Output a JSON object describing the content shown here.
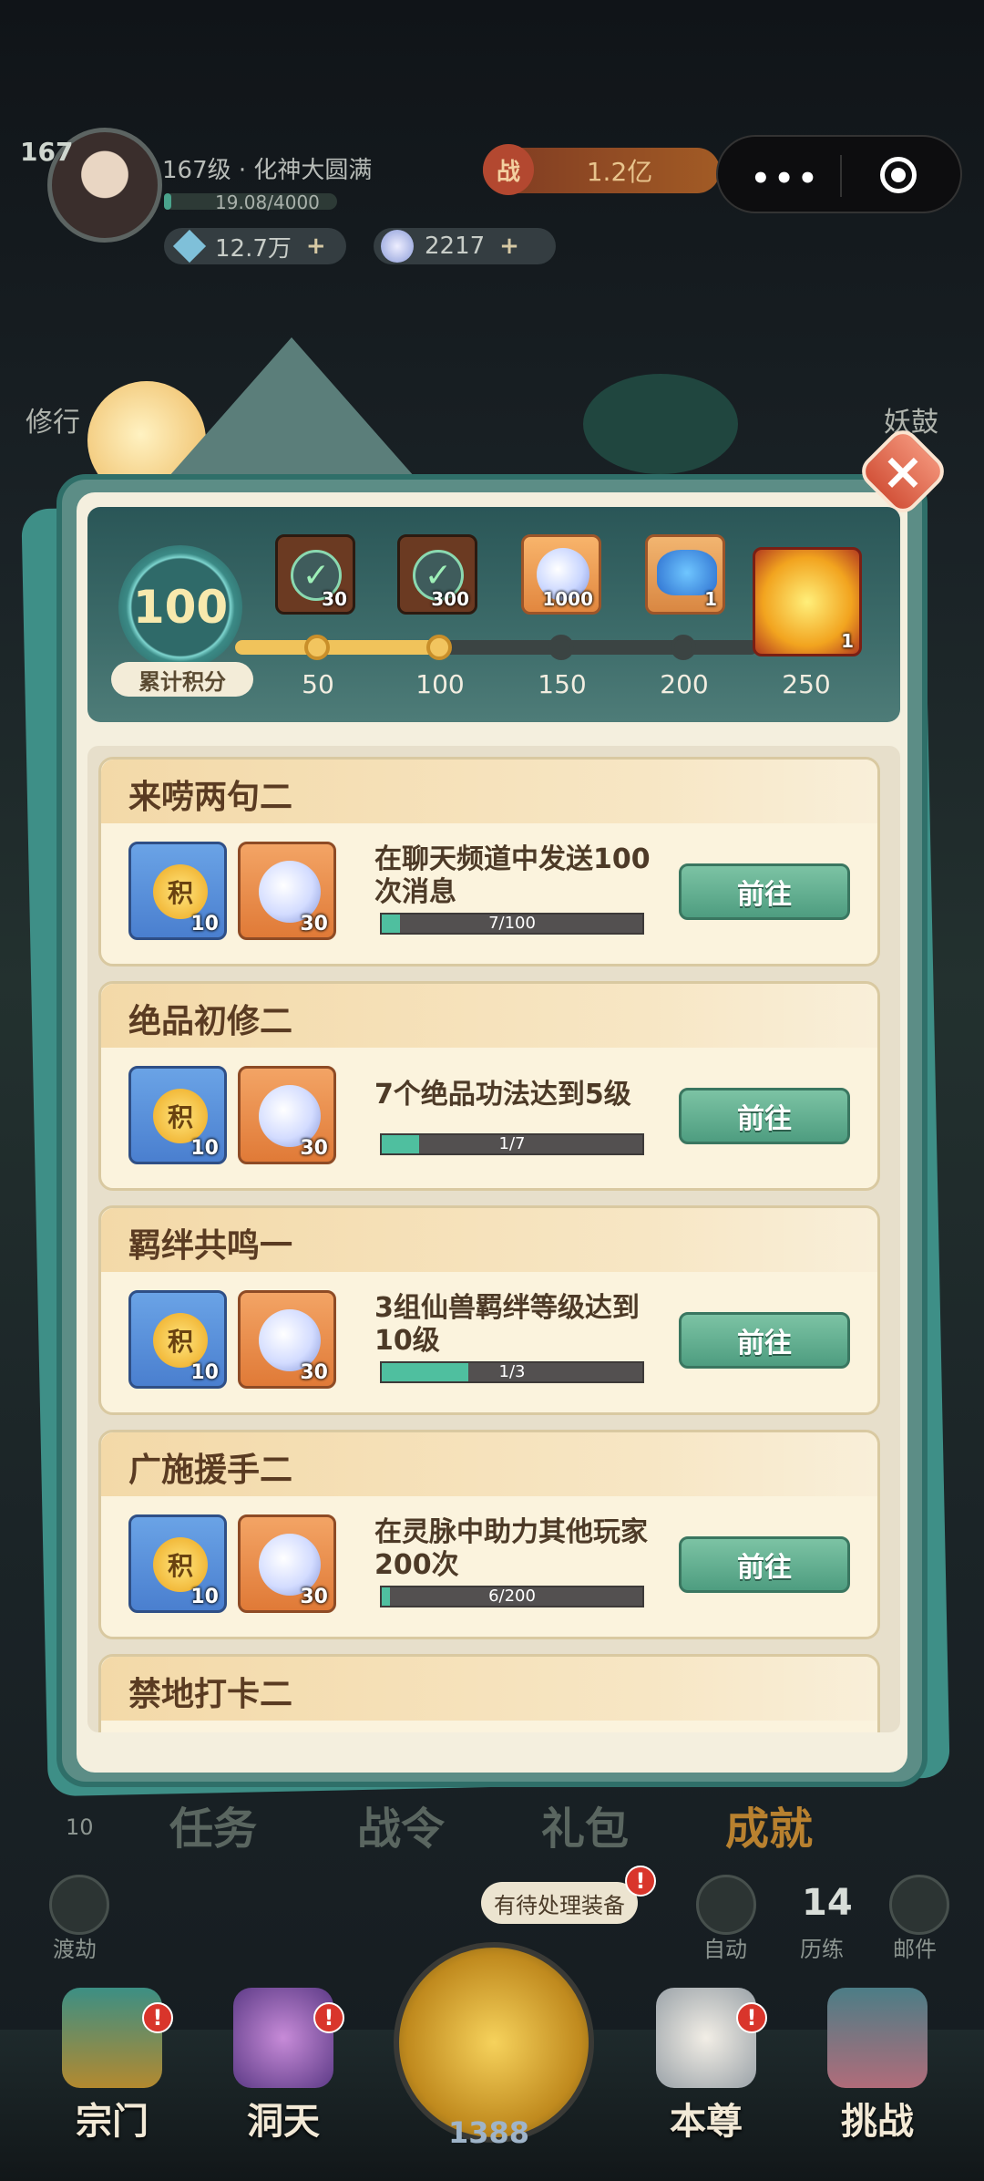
{
  "hud": {
    "avatar_level": "167",
    "realm": "167级 · 化神大圆满",
    "xp_text": "19.08/4000",
    "xp_fraction": 0.005,
    "spirit_stones": "12.7万",
    "soul_orbs": "2217",
    "plus": "+",
    "power_icon": "战",
    "power": "1.2亿",
    "capsule_more": "•••",
    "left_label": "修行",
    "right_label": "妖鼓"
  },
  "panel": {
    "close_icon": "×",
    "progress": {
      "score": "100",
      "score_label": "累计积分",
      "fill_fraction": 0.4,
      "milestones": [
        {
          "label": "50",
          "reward": "claimed",
          "qty": "30",
          "done": true
        },
        {
          "label": "100",
          "reward": "claimed",
          "qty": "300",
          "done": true
        },
        {
          "label": "150",
          "reward": "gem",
          "qty": "1000",
          "done": false
        },
        {
          "label": "200",
          "reward": "beast",
          "qty": "1",
          "done": false
        },
        {
          "label": "250",
          "reward": "hero",
          "qty": "1",
          "done": false
        }
      ],
      "check_glyph": "✓"
    },
    "quests": [
      {
        "title": "来唠两句二",
        "desc": "在聊天频道中发送100次消息",
        "progress": "7/100",
        "fraction": 0.07,
        "score_qty": "10",
        "soul_qty": "30",
        "button": "前往"
      },
      {
        "title": "绝品初修二",
        "desc": "7个绝品功法达到5级",
        "progress": "1/7",
        "fraction": 0.1428,
        "score_qty": "10",
        "soul_qty": "30",
        "button": "前往"
      },
      {
        "title": "羁绊共鸣一",
        "desc": "3组仙兽羁绊等级达到10级",
        "progress": "1/3",
        "fraction": 0.333,
        "score_qty": "10",
        "soul_qty": "30",
        "button": "前往"
      },
      {
        "title": "广施援手二",
        "desc": "在灵脉中助力其他玩家200次",
        "progress": "6/200",
        "fraction": 0.03,
        "score_qty": "10",
        "soul_qty": "30",
        "button": "前往"
      },
      {
        "title": "禁地打卡二"
      }
    ],
    "coin_glyph": "积"
  },
  "bottom": {
    "tabs": [
      "任务",
      "战令",
      "礼包",
      "成就"
    ],
    "left_count": "10",
    "dujie": "渡劫",
    "pending_tip": "有待处理装备",
    "auto": "自动",
    "trial_count": "14",
    "trial": "历练",
    "mail": "邮件",
    "sword_count": "1388",
    "badge": "!",
    "nav": [
      "宗门",
      "洞天",
      "",
      "本尊",
      "挑战"
    ]
  },
  "colors": {
    "accent_teal": "#4fbf9f",
    "gold": "#f0c35b",
    "button_green": "#4e9d80",
    "power_orange": "#a25b25",
    "badge_red": "#d9352b"
  }
}
